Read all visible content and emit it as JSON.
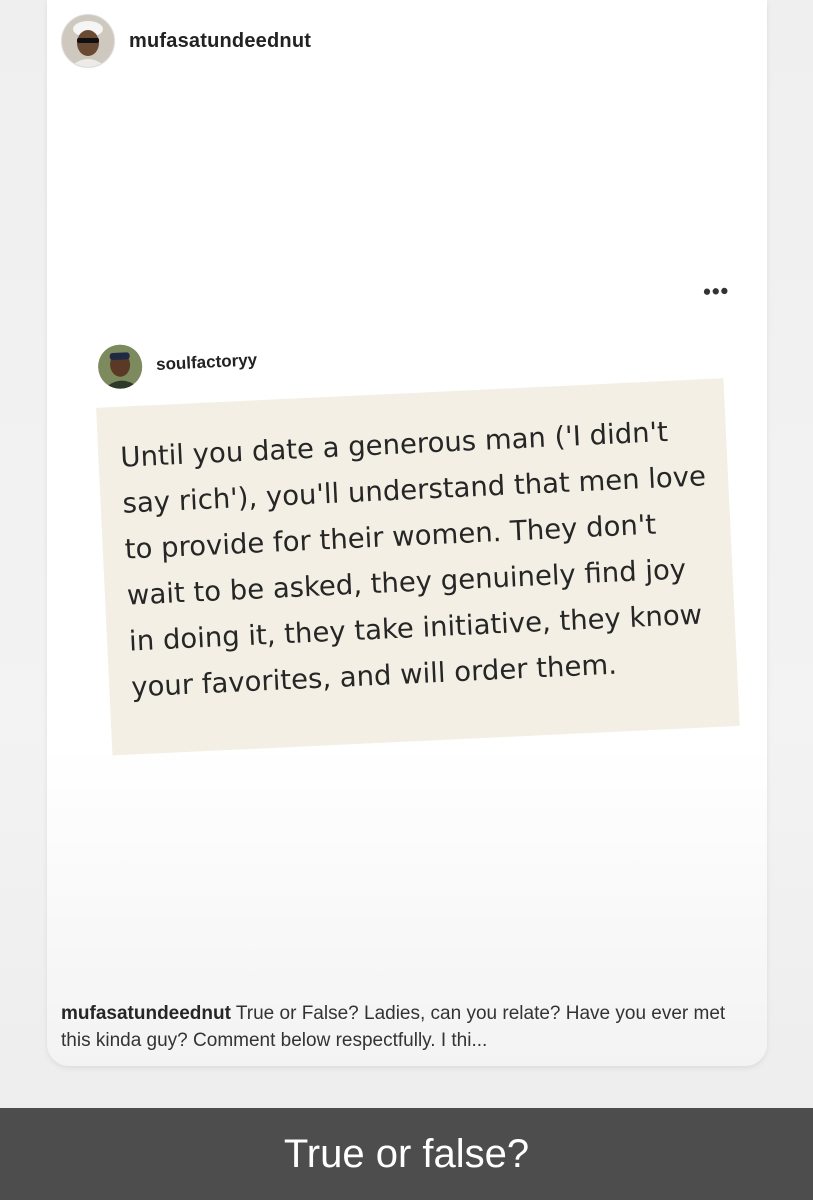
{
  "post": {
    "username": "mufasatundeednut",
    "more_icon": "more-horizontal-icon",
    "more_glyph": "•••"
  },
  "embedded_post": {
    "username": "soulfactoryy",
    "quote": "Until you date a generous man ('I didn't say rich'), you'll understand that men love to provide for their women. They don't wait to be asked, they genuinely find joy in doing it, they take initiative, they know your favorites, and will order them.",
    "quote_bg_color": "#f3efe4"
  },
  "caption": {
    "username": "mufasatundeednut",
    "text": "True or False? Ladies, can you relate? Have you ever met this kinda guy? Comment below respectfully. I thi..."
  },
  "banner": {
    "text": "True or false?",
    "bg_color": "#4d4d4d"
  }
}
